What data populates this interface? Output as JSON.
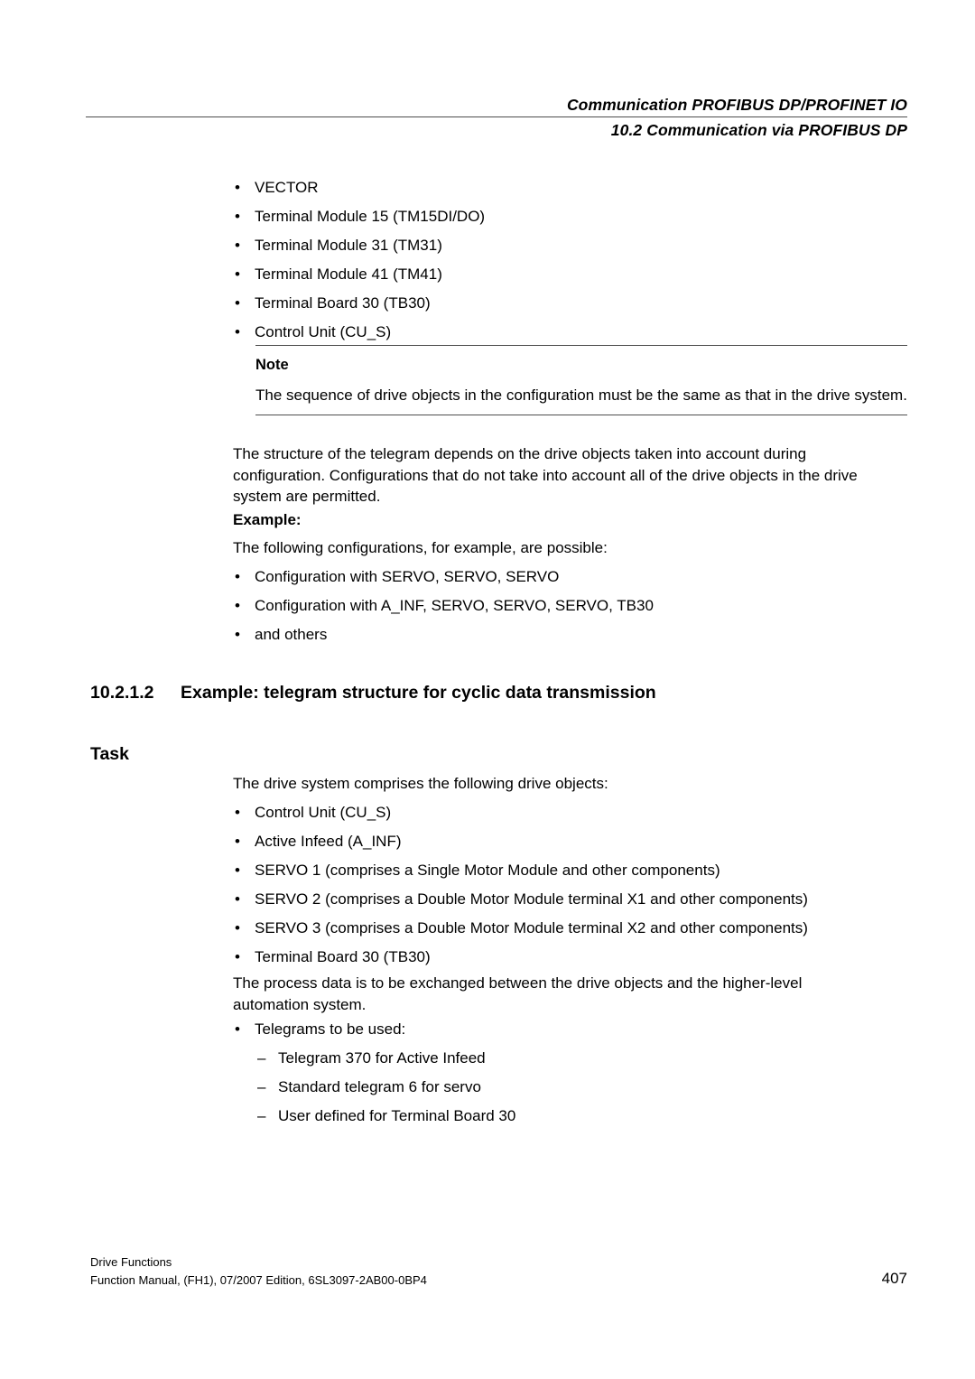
{
  "header": {
    "line1": "Communication PROFIBUS DP/PROFINET IO",
    "line2": "10.2 Communication via PROFIBUS DP"
  },
  "top_list": {
    "bullet_glyph": "•",
    "items": [
      "VECTOR",
      "Terminal Module 15 (TM15DI/DO)",
      "Terminal Module 31 (TM31)",
      "Terminal Module 41 (TM41)",
      "Terminal Board 30 (TB30)",
      "Control Unit (CU_S)"
    ]
  },
  "note": {
    "title": "Note",
    "text": "The sequence of drive objects in the configuration must be the same as that in the drive system."
  },
  "intro_paragraph": "The structure of the telegram depends on the drive objects taken into account during configuration. Configurations that do not take into account all of the drive objects in the drive system are permitted.",
  "example": {
    "label": "Example:",
    "lead": "The following configurations, for example, are possible:",
    "bullet_glyph": "•",
    "items": [
      "Configuration with SERVO, SERVO, SERVO",
      "Configuration with A_INF, SERVO, SERVO, SERVO, TB30",
      "and others"
    ]
  },
  "section": {
    "number": "10.2.1.2",
    "title": "Example: telegram structure for cyclic data transmission"
  },
  "task": {
    "heading": "Task",
    "lead": "The drive system comprises the following drive objects:",
    "bullet_glyph": "•",
    "objects": [
      "Control Unit (CU_S)",
      "Active Infeed (A_INF)",
      "SERVO 1 (comprises a Single Motor Module and other components)",
      "SERVO 2 (comprises a Double Motor Module terminal X1 and other components)",
      "SERVO 3 (comprises a Double Motor Module terminal X2 and other components)",
      "Terminal Board 30 (TB30)"
    ],
    "process_paragraph": "The process data is to be exchanged between the drive objects and the higher-level automation system.",
    "telegrams_label": "Telegrams to be used:",
    "dash_glyph": "–",
    "telegrams": [
      "Telegram 370 for Active Infeed",
      "Standard telegram 6 for servo",
      "User defined for Terminal Board 30"
    ]
  },
  "footer": {
    "line1": "Drive Functions",
    "line2": "Function Manual, (FH1), 07/2007 Edition, 6SL3097-2AB00-0BP4",
    "page": "407"
  }
}
